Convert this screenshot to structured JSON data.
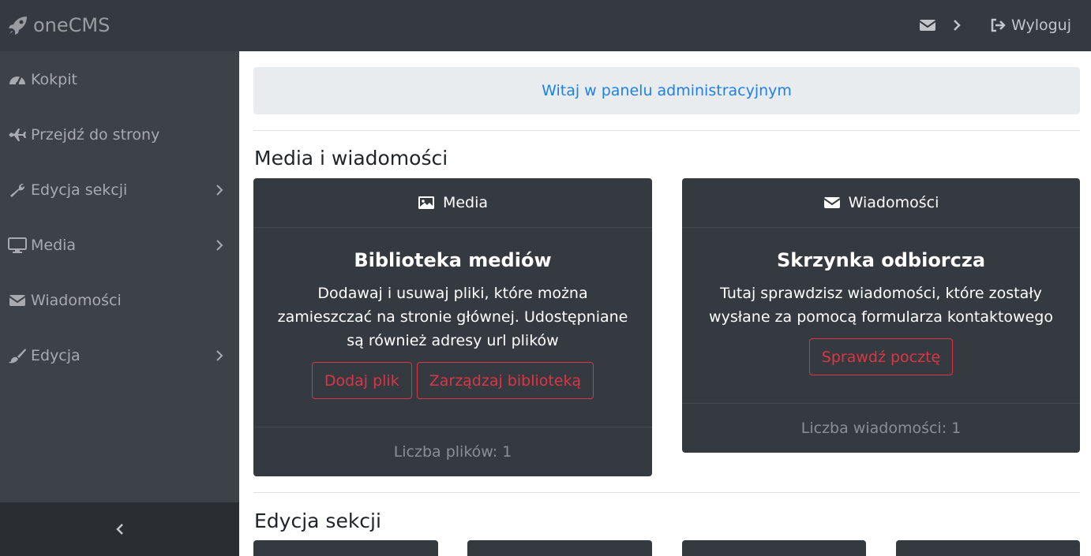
{
  "brand": {
    "name": "oneCMS",
    "icon": "rocket-icon"
  },
  "topbar": {
    "logout_label": "Wyloguj"
  },
  "sidebar": {
    "items": [
      {
        "label": "Kokpit",
        "icon": "tachometer-icon",
        "has_submenu": false
      },
      {
        "label": "Przejdź do strony",
        "icon": "plane-icon",
        "has_submenu": false
      },
      {
        "label": "Edycja sekcji",
        "icon": "wrench-icon",
        "has_submenu": true
      },
      {
        "label": "Media",
        "icon": "desktop-icon",
        "has_submenu": true
      },
      {
        "label": "Wiadomości",
        "icon": "envelope-icon",
        "has_submenu": false
      },
      {
        "label": "Edycja",
        "icon": "paint-brush-icon",
        "has_submenu": true
      }
    ]
  },
  "main": {
    "welcome": "Witaj w panelu administracyjnym",
    "section1_title": "Media i wiadomości",
    "section2_title": "Edycja sekcji",
    "media_card": {
      "header": "Media",
      "title": "Biblioteka mediów",
      "text": "Dodawaj i usuwaj pliki, które można zamieszczać na stronie głównej. Udostępniane są również adresy url plików",
      "button_add": "Dodaj plik",
      "button_manage": "Zarządzaj biblioteką",
      "footer": "Liczba plików: 1"
    },
    "messages_card": {
      "header": "Wiadomości",
      "title": "Skrzynka odbiorcza",
      "text": "Tutaj sprawdzisz wiadomości, które zostały wysłane za pomocą formularza kontaktowego",
      "button_check": "Sprawdź pocztę",
      "footer": "Liczba wiadomości: 1"
    }
  },
  "colors": {
    "navbar_bg": "#343a40",
    "sidebar_bg": "#3d4248",
    "accent_link": "#1f80e5",
    "danger": "#dc3545"
  }
}
